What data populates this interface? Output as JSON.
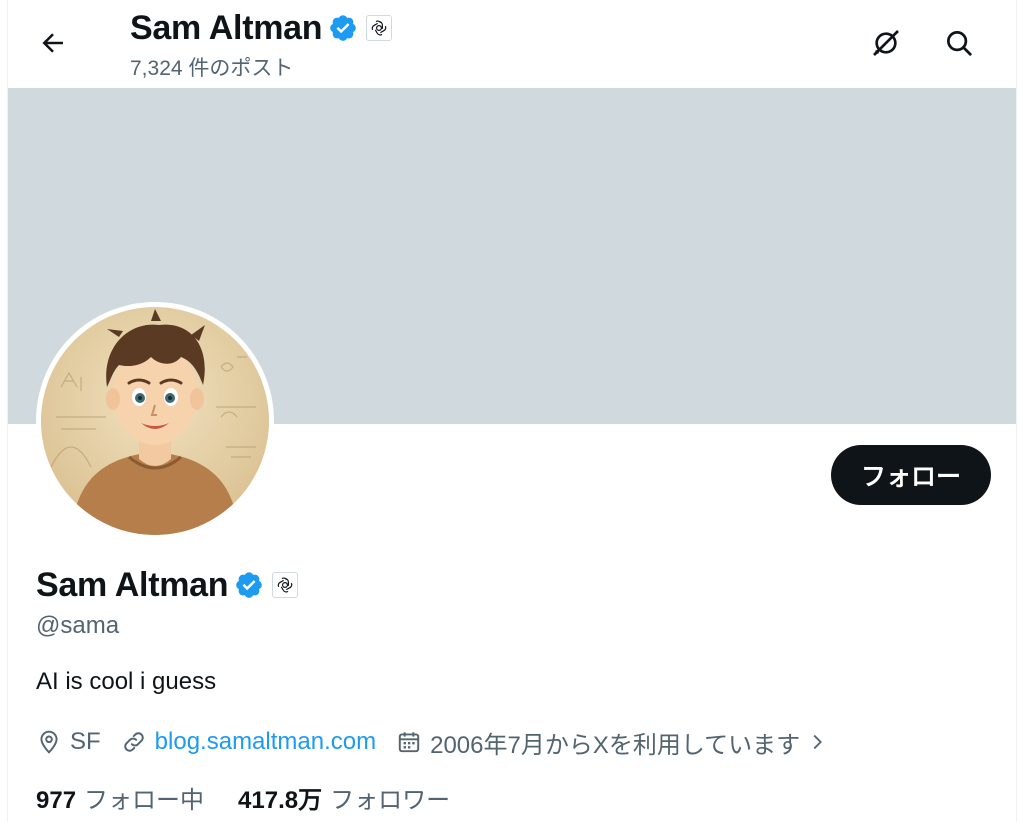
{
  "header": {
    "name": "Sam Altman",
    "post_count": "7,324 件のポスト",
    "back_icon": "arrow-left-icon",
    "grok_icon": "grok-icon",
    "search_icon": "search-icon"
  },
  "profile": {
    "name": "Sam Altman",
    "handle": "@sama",
    "bio": "AI is cool i guess",
    "verified": true,
    "affiliate_badge": "openai-logo",
    "location": "SF",
    "website": "blog.samaltman.com",
    "joined": "2006年7月からXを利用しています",
    "follow_button": "フォロー",
    "following": {
      "count": "977",
      "label": "フォロー中"
    },
    "followers": {
      "count": "417.8万",
      "label": "フォロワー"
    }
  },
  "colors": {
    "banner": "#cfd9de",
    "verified_blue": "#1d9bf0",
    "button_bg": "#0f1419",
    "secondary_text": "#536471"
  }
}
